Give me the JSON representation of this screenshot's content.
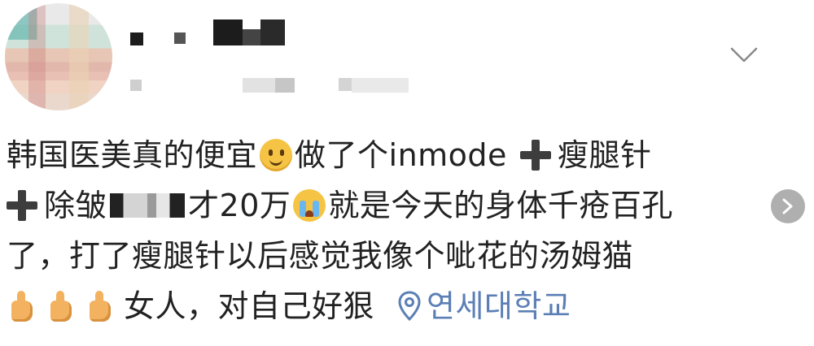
{
  "header": {
    "avatar": "avatar-image",
    "chevron_icon": "chevron-down-icon"
  },
  "post": {
    "line1": {
      "a": "韩国医美真的便宜",
      "b": "做了个inmode",
      "c": "瘦腿针"
    },
    "line2": {
      "a": "除皱",
      "b": "才20万",
      "c": "就是今天的身体千疮百孔"
    },
    "line3": "了，打了瘦腿针以后感觉我像个呲花的汤姆猫",
    "line4": {
      "text": "女人，对自己好狠",
      "location": "연세대학교"
    }
  },
  "icons": {
    "smile": "slightly-smiling-face-icon",
    "cry": "loudly-crying-face-icon",
    "plus": "heavy-plus-icon",
    "thumb": "thumbs-up-icon",
    "location": "location-pin-icon",
    "next": "chevron-right-icon"
  },
  "colors": {
    "text": "#222222",
    "location": "#5b7fb5"
  }
}
